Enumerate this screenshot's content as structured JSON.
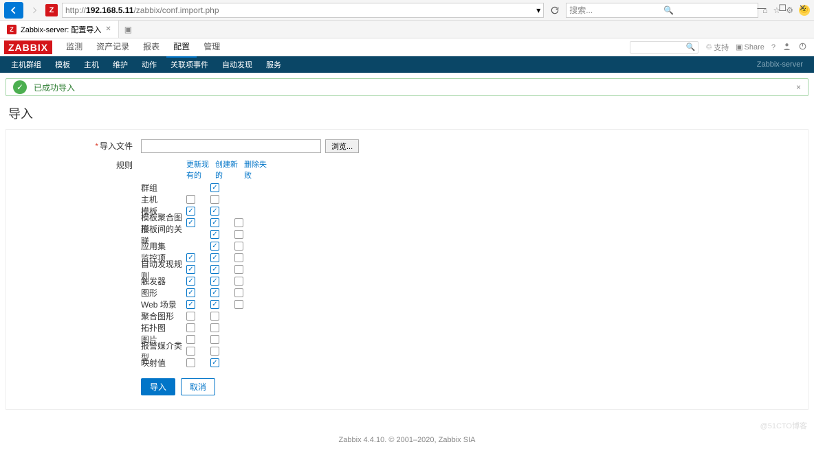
{
  "window": {
    "min": "—",
    "max": "☐",
    "close": "✕"
  },
  "browser": {
    "url_prefix": "http://",
    "url_host": "192.168.5.11",
    "url_path": "/zabbix/conf.import.php",
    "search_placeholder": "搜索..."
  },
  "tab": {
    "title": "Zabbix-server: 配置导入",
    "close": "✕"
  },
  "topmenu": {
    "items": [
      "监测",
      "资产记录",
      "报表",
      "配置",
      "管理"
    ],
    "selected": 3
  },
  "header_right": {
    "support": "支持",
    "share": "Share",
    "help": "?"
  },
  "subnav": {
    "items": [
      "主机群组",
      "模板",
      "主机",
      "维护",
      "动作",
      "关联项事件",
      "自动发现",
      "服务"
    ],
    "server": "Zabbix-server"
  },
  "banner": {
    "text": "已成功导入"
  },
  "page": {
    "title": "导入"
  },
  "form": {
    "file_label": "导入文件",
    "browse": "浏览...",
    "rules_label": "规则",
    "col_headers": [
      "更新现有的",
      "创建新的",
      "删除失败"
    ],
    "rules": [
      {
        "label": "群组",
        "states": [
          null,
          true,
          null
        ]
      },
      {
        "label": "主机",
        "states": [
          false,
          false,
          null
        ]
      },
      {
        "label": "模板",
        "states": [
          true,
          true,
          null
        ]
      },
      {
        "label": "模板聚合图形",
        "states": [
          true,
          true,
          false
        ]
      },
      {
        "label": "模板间的关联",
        "states": [
          null,
          true,
          false
        ]
      },
      {
        "label": "应用集",
        "states": [
          null,
          true,
          false
        ]
      },
      {
        "label": "监控项",
        "states": [
          true,
          true,
          false
        ]
      },
      {
        "label": "自动发现规则",
        "states": [
          true,
          true,
          false
        ]
      },
      {
        "label": "触发器",
        "states": [
          true,
          true,
          false
        ]
      },
      {
        "label": "图形",
        "states": [
          true,
          true,
          false
        ]
      },
      {
        "label": "Web 场景",
        "states": [
          true,
          true,
          false
        ]
      },
      {
        "label": "聚合图形",
        "states": [
          false,
          false,
          null
        ]
      },
      {
        "label": "拓扑图",
        "states": [
          false,
          false,
          null
        ]
      },
      {
        "label": "图片",
        "states": [
          false,
          false,
          null
        ]
      },
      {
        "label": "报警媒介类型",
        "states": [
          false,
          false,
          null
        ]
      },
      {
        "label": "映射值",
        "states": [
          false,
          true,
          null
        ]
      }
    ],
    "submit": "导入",
    "cancel": "取消"
  },
  "footer": {
    "text": "Zabbix 4.4.10. © 2001–2020, Zabbix SIA"
  },
  "watermark": "@51CTO博客"
}
